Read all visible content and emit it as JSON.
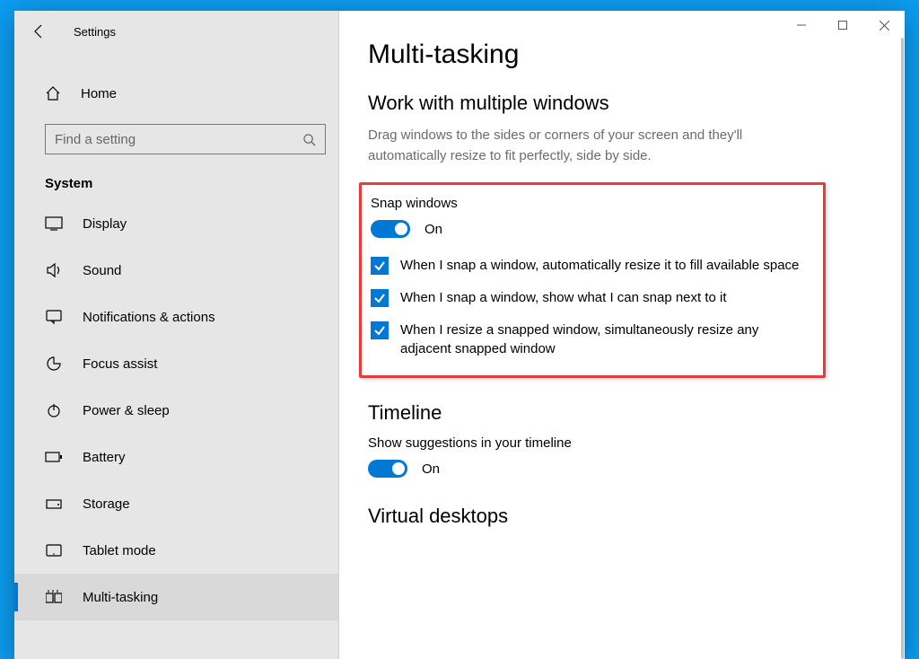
{
  "window": {
    "title": "Settings"
  },
  "sidebar": {
    "home_label": "Home",
    "search_placeholder": "Find a setting",
    "category_label": "System",
    "items": [
      {
        "label": "Display"
      },
      {
        "label": "Sound"
      },
      {
        "label": "Notifications & actions"
      },
      {
        "label": "Focus assist"
      },
      {
        "label": "Power & sleep"
      },
      {
        "label": "Battery"
      },
      {
        "label": "Storage"
      },
      {
        "label": "Tablet mode"
      },
      {
        "label": "Multi-tasking"
      }
    ]
  },
  "content": {
    "page_title": "Multi-tasking",
    "section_multiwindow": {
      "heading": "Work with multiple windows",
      "description": "Drag windows to the sides or corners of your screen and they'll automatically resize to fit perfectly, side by side.",
      "snap_label": "Snap windows",
      "snap_toggle_state": "On",
      "checks": [
        "When I snap a window, automatically resize it to fill available space",
        "When I snap a window, show what I can snap next to it",
        "When I resize a snapped window, simultaneously resize any adjacent snapped window"
      ]
    },
    "section_timeline": {
      "heading": "Timeline",
      "suggestions_label": "Show suggestions in your timeline",
      "toggle_state": "On"
    },
    "section_virtual": {
      "heading": "Virtual desktops"
    }
  }
}
